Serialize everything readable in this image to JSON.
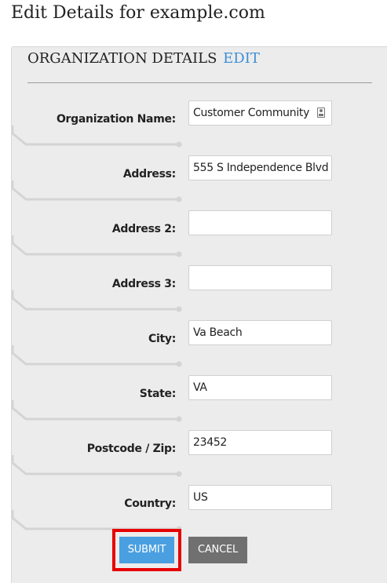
{
  "page": {
    "title": "Edit Details for example.com"
  },
  "section": {
    "heading": "ORGANIZATION DETAILS",
    "edit_label": "EDIT"
  },
  "fields": {
    "organization_name": {
      "label": "Organization Name:",
      "value": "Customer Community"
    },
    "address": {
      "label": "Address:",
      "value": "555 S Independence Blvd"
    },
    "address2": {
      "label": "Address 2:",
      "value": ""
    },
    "address3": {
      "label": "Address 3:",
      "value": ""
    },
    "city": {
      "label": "City:",
      "value": "Va Beach"
    },
    "state": {
      "label": "State:",
      "value": "VA"
    },
    "postcode": {
      "label": "Postcode / Zip:",
      "value": "23452"
    },
    "country": {
      "label": "Country:",
      "value": "US"
    }
  },
  "buttons": {
    "submit_label": "SUBMIT",
    "cancel_label": "CANCEL"
  },
  "icons": {
    "autofill": "contact-card-icon"
  },
  "colors": {
    "link": "#3d8fd6",
    "submit": "#4a9fe0",
    "cancel": "#707070",
    "highlight": "#e60000",
    "panel": "#ececec"
  }
}
